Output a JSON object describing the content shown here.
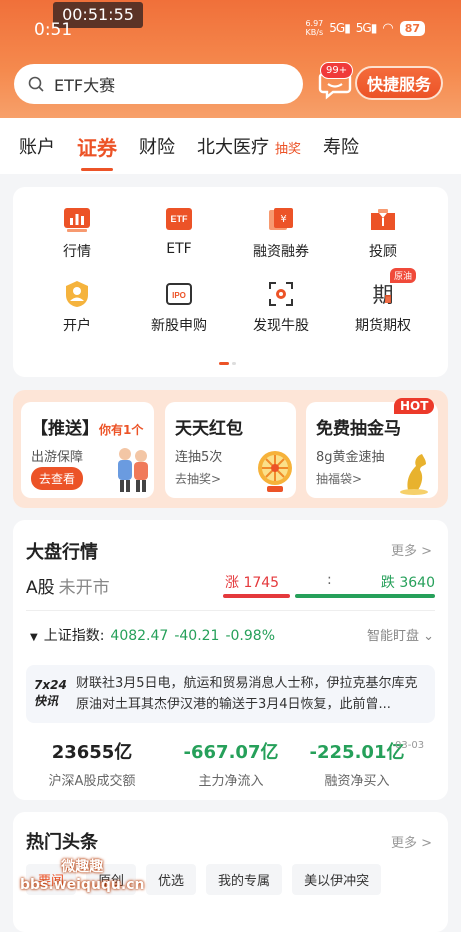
{
  "status_bar": {
    "recording_timer": "00:51:55",
    "time": "0:51",
    "net_speed_value": "6.97",
    "net_speed_unit": "KB/s",
    "signal1": "5G",
    "signal2": "5G",
    "battery": "87"
  },
  "search": {
    "placeholder": "ETF大赛"
  },
  "messages": {
    "badge": "99+"
  },
  "quick_service": {
    "label": "快捷服务"
  },
  "top_tabs": [
    {
      "label": "账户"
    },
    {
      "label": "证券",
      "active": true
    },
    {
      "label": "财险"
    },
    {
      "label": "北大医疗",
      "tag": "抽奖"
    },
    {
      "label": "寿险"
    }
  ],
  "grid": {
    "items": [
      {
        "label": "行情",
        "icon": "bar-chart-icon"
      },
      {
        "label": "ETF",
        "icon": "etf-icon"
      },
      {
        "label": "融资融券",
        "icon": "yen-doc-icon"
      },
      {
        "label": "投顾",
        "icon": "advisor-icon"
      },
      {
        "label": "开户",
        "icon": "user-icon"
      },
      {
        "label": "新股申购",
        "icon": "ipo-icon"
      },
      {
        "label": "发现牛股",
        "icon": "scan-icon"
      },
      {
        "label": "期货期权",
        "icon": "futures-icon",
        "badge": "原油"
      }
    ]
  },
  "promos": [
    {
      "title_prefix": "【推送】",
      "title_tag": "你有1个",
      "sub": "出游保障",
      "button": "去查看"
    },
    {
      "title": "天天红包",
      "sub": "连抽5次",
      "link": "去抽奖>"
    },
    {
      "title": "免费抽金马",
      "sub": "8g黄金速抽",
      "link": "抽福袋>",
      "badge": "HOT"
    }
  ],
  "market": {
    "title": "大盘行情",
    "more": "更多 >",
    "a_share": "A股",
    "status": "未开市",
    "up_label": "涨 1745",
    "colon": ":",
    "down_label": "跌 3640",
    "up_ratio": 0.3241,
    "index_name": "上证指数:",
    "index_value": "4082.47",
    "index_change": "-40.21",
    "index_pct": "-0.98%",
    "smart": "智能盯盘",
    "news_logo_1": "7x24",
    "news_logo_2": "快讯",
    "news_text": "财联社3月5日电，航运和贸易消息人士称，伊拉克基尔库克原油对土耳其杰伊汉港的输送于3月4日恢复，此前曾...",
    "stats": [
      {
        "value": "23655亿",
        "label": "沪深A股成交额"
      },
      {
        "value": "-667.07亿",
        "label": "主力净流入"
      },
      {
        "value": "-225.01亿",
        "label": "融资净买入"
      }
    ],
    "stats_date": "03-03"
  },
  "hot": {
    "title": "热门头条",
    "more": "更多 >",
    "chips": [
      "要闻",
      "原创",
      "优选",
      "我的专属",
      "美以伊冲突"
    ]
  },
  "watermark": {
    "line1": "微趣趣",
    "line2": "bbs.weiququ.cn"
  },
  "colors": {
    "brand": "#ec5327",
    "up": "#e4393c",
    "down": "#26a05a"
  }
}
